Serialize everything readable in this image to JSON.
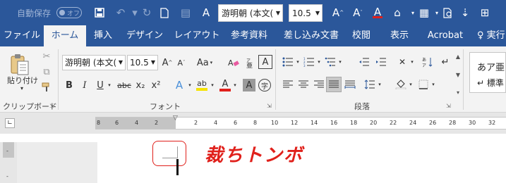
{
  "quick_access": {
    "autosave_label": "自動保存",
    "autosave_state": "オフ",
    "font_name": "游明朝 (本文(",
    "font_size": "10.5",
    "icons": [
      "save-icon",
      "undo-icon",
      "redo-icon",
      "new-document-icon",
      "format-painter-icon",
      "font-color-icon",
      "grow-font-icon",
      "shrink-font-icon",
      "clear-format-icon",
      "table-icon",
      "print-preview-icon",
      "customize-icon"
    ]
  },
  "tabs": [
    {
      "label": "ファイル"
    },
    {
      "label": "ホーム"
    },
    {
      "label": "挿入"
    },
    {
      "label": "デザイン"
    },
    {
      "label": "レイアウト"
    },
    {
      "label": "参考資料"
    },
    {
      "label": "差し込み文書"
    },
    {
      "label": "校閲"
    },
    {
      "label": "表示"
    },
    {
      "label": "Acrobat"
    },
    {
      "label": "実行"
    }
  ],
  "ribbon": {
    "clipboard": {
      "paste_label": "貼り付け",
      "group_label": "クリップボード"
    },
    "font": {
      "font_name": "游明朝 (本文(",
      "font_size": "10.5",
      "change_case": "Aa",
      "group_label": "フォント",
      "bold": "B",
      "italic": "I",
      "underline": "U",
      "strike": "abc",
      "subscript": "x₂",
      "superscript": "x²",
      "font_color_hex": "#e0201b",
      "highlight_hex": "#f5e300"
    },
    "paragraph": {
      "group_label": "段落"
    },
    "styles": {
      "sample_text": "あア亜",
      "sample_name": "標準"
    }
  },
  "ruler": {
    "ticks": [
      "8",
      "6",
      "4",
      "2",
      "2",
      "4",
      "6",
      "8",
      "10",
      "12",
      "14",
      "16",
      "18",
      "20",
      "22",
      "24",
      "26",
      "28",
      "30",
      "32"
    ]
  },
  "document": {
    "annotation_text": "裁ちトンボ",
    "annotation_color": "#e0201b"
  }
}
